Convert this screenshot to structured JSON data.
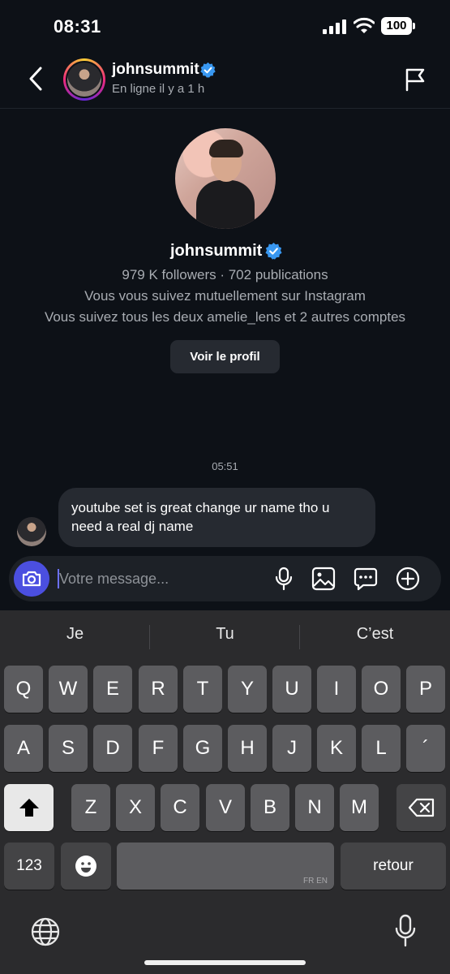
{
  "status_bar": {
    "time": "08:31",
    "battery": "100"
  },
  "header": {
    "username": "johnsummit",
    "status": "En ligne il y a 1 h",
    "icons": [
      "back-icon",
      "verified-badge-icon",
      "flag-icon"
    ]
  },
  "profile": {
    "username": "johnsummit",
    "stats": "979 K followers · 702 publications",
    "mutual": "Vous vous suivez mutuellement sur Instagram",
    "follows": "Vous suivez tous les deux amelie_lens et 2 autres comptes",
    "view_profile_label": "Voir le profil"
  },
  "conversation": {
    "timestamp": "05:51",
    "messages": [
      {
        "from": "johnsummit",
        "text": "youtube set is great change ur name tho u need a real dj name"
      }
    ]
  },
  "composer": {
    "placeholder": "Votre message...",
    "icons": [
      "camera-icon",
      "microphone-icon",
      "gallery-icon",
      "sticker-icon",
      "plus-icon"
    ],
    "accent": "#4b4fe0"
  },
  "keyboard": {
    "suggestions": [
      "Je",
      "Tu",
      "C’est"
    ],
    "row1": [
      "Q",
      "W",
      "E",
      "R",
      "T",
      "Y",
      "U",
      "I",
      "O",
      "P"
    ],
    "row2": [
      "A",
      "S",
      "D",
      "F",
      "G",
      "H",
      "J",
      "K",
      "L",
      "´"
    ],
    "row3": [
      "Z",
      "X",
      "C",
      "V",
      "B",
      "N",
      "M"
    ],
    "numbers_label": "123",
    "space_langs": "FR EN",
    "return_label": "retour",
    "icons": [
      "shift-icon",
      "backspace-icon",
      "emoji-icon",
      "globe-icon",
      "dictation-icon"
    ]
  }
}
